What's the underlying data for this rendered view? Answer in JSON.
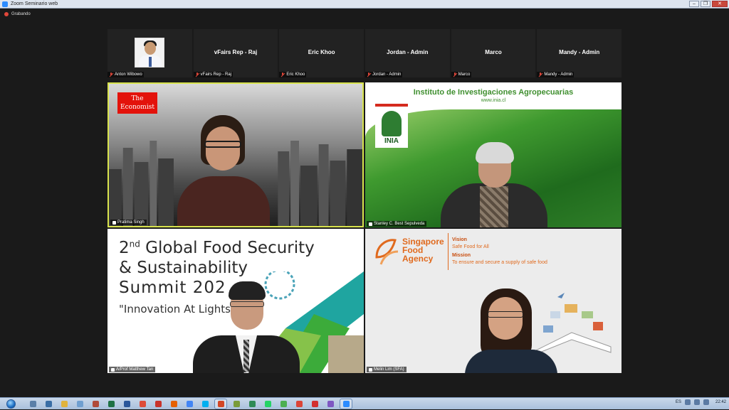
{
  "window": {
    "title": "Zoom Seminario web",
    "buttons": {
      "minimize": "–",
      "restore": "❐",
      "close": "✕"
    }
  },
  "recording": {
    "label": "Grabando"
  },
  "strip": {
    "tiles": [
      {
        "name": "",
        "footer": "Anton Wibowo",
        "has_avatar": true
      },
      {
        "name": "vFairs Rep - Raj",
        "footer": "vFairs Rep - Raj"
      },
      {
        "name": "Eric Khoo",
        "footer": "Eric Khoo"
      },
      {
        "name": "Jordan - Admin",
        "footer": "Jordan - Admin"
      },
      {
        "name": "Marco",
        "footer": "Marco"
      },
      {
        "name": "Mandy - Admin",
        "footer": "Mandy - Admin"
      }
    ]
  },
  "videos": {
    "v1": {
      "name": "Pratima Singh",
      "logo_line1": "The",
      "logo_line2": "Economist"
    },
    "v2": {
      "name": "Stanley C. Best Sepulveda",
      "title": "Instituto de Investigaciones Agropecuarias",
      "url": "www.inia.cl",
      "logo_text": "INIA"
    },
    "v3": {
      "name": "A/Prof Matthew Tan",
      "line1_pre": "2",
      "line1_sup": "nd",
      "line1_post": " Global Food Security",
      "line2": "& Sustainability",
      "line3": "Summit 202",
      "line4": "\"Innovation At Lightspe"
    },
    "v4": {
      "name": "Melin Lim (SFA)",
      "brand_line1": "Singapore",
      "brand_line2": "Food",
      "brand_line3": "Agency",
      "vision_label": "Vision",
      "vision_text": "Safe Food for All",
      "mission_label": "Mission",
      "mission_text": "To ensure and secure a supply of safe food"
    }
  },
  "taskbar": {
    "language": "ES",
    "clock": "22:42",
    "icons": [
      "explorer-icon",
      "media-icon",
      "notes-icon",
      "files-icon",
      "app-icon",
      "excel-icon",
      "word-icon",
      "chrome-icon",
      "red-app-icon",
      "firefox-icon",
      "translate-icon",
      "skype-icon",
      "powerpoint-icon",
      "pen-icon",
      "globe-icon",
      "whatsapp-icon",
      "green-icon",
      "chrome2-icon",
      "plus-icon",
      "paint-icon",
      "zoom-icon"
    ]
  },
  "colors": {
    "active_speaker_border": "#d8e34d",
    "economist_red": "#e3120b",
    "inia_green": "#3f8f2f",
    "sfa_orange": "#e06a1e",
    "mic_muted": "#e0473a"
  }
}
